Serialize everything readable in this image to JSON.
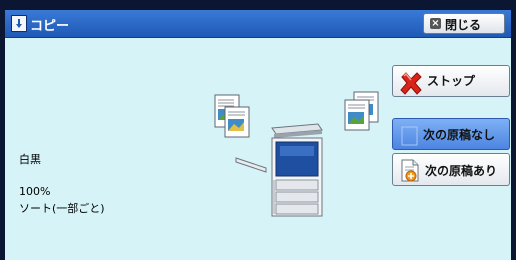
{
  "window": {
    "title": "コピー",
    "close_label": "閉じる"
  },
  "buttons": {
    "stop": "ストップ",
    "no_next_original": "次の原稿なし",
    "next_original": "次の原稿あり"
  },
  "status": {
    "color_mode": "白黒",
    "zoom": "100%",
    "collation": "ソート(一部ごと)"
  },
  "icons": {
    "title": "info-icon",
    "close": "close-icon",
    "stop": "red-x-icon",
    "no_next": "blank-document-icon",
    "next": "document-add-icon",
    "machine": "copier-machine-icon"
  },
  "colors": {
    "titlebar": "#2a68c8",
    "screen_bg": "#d6f4f8",
    "selected_button": "#5e96ec",
    "stop_icon": "#d8241a"
  }
}
